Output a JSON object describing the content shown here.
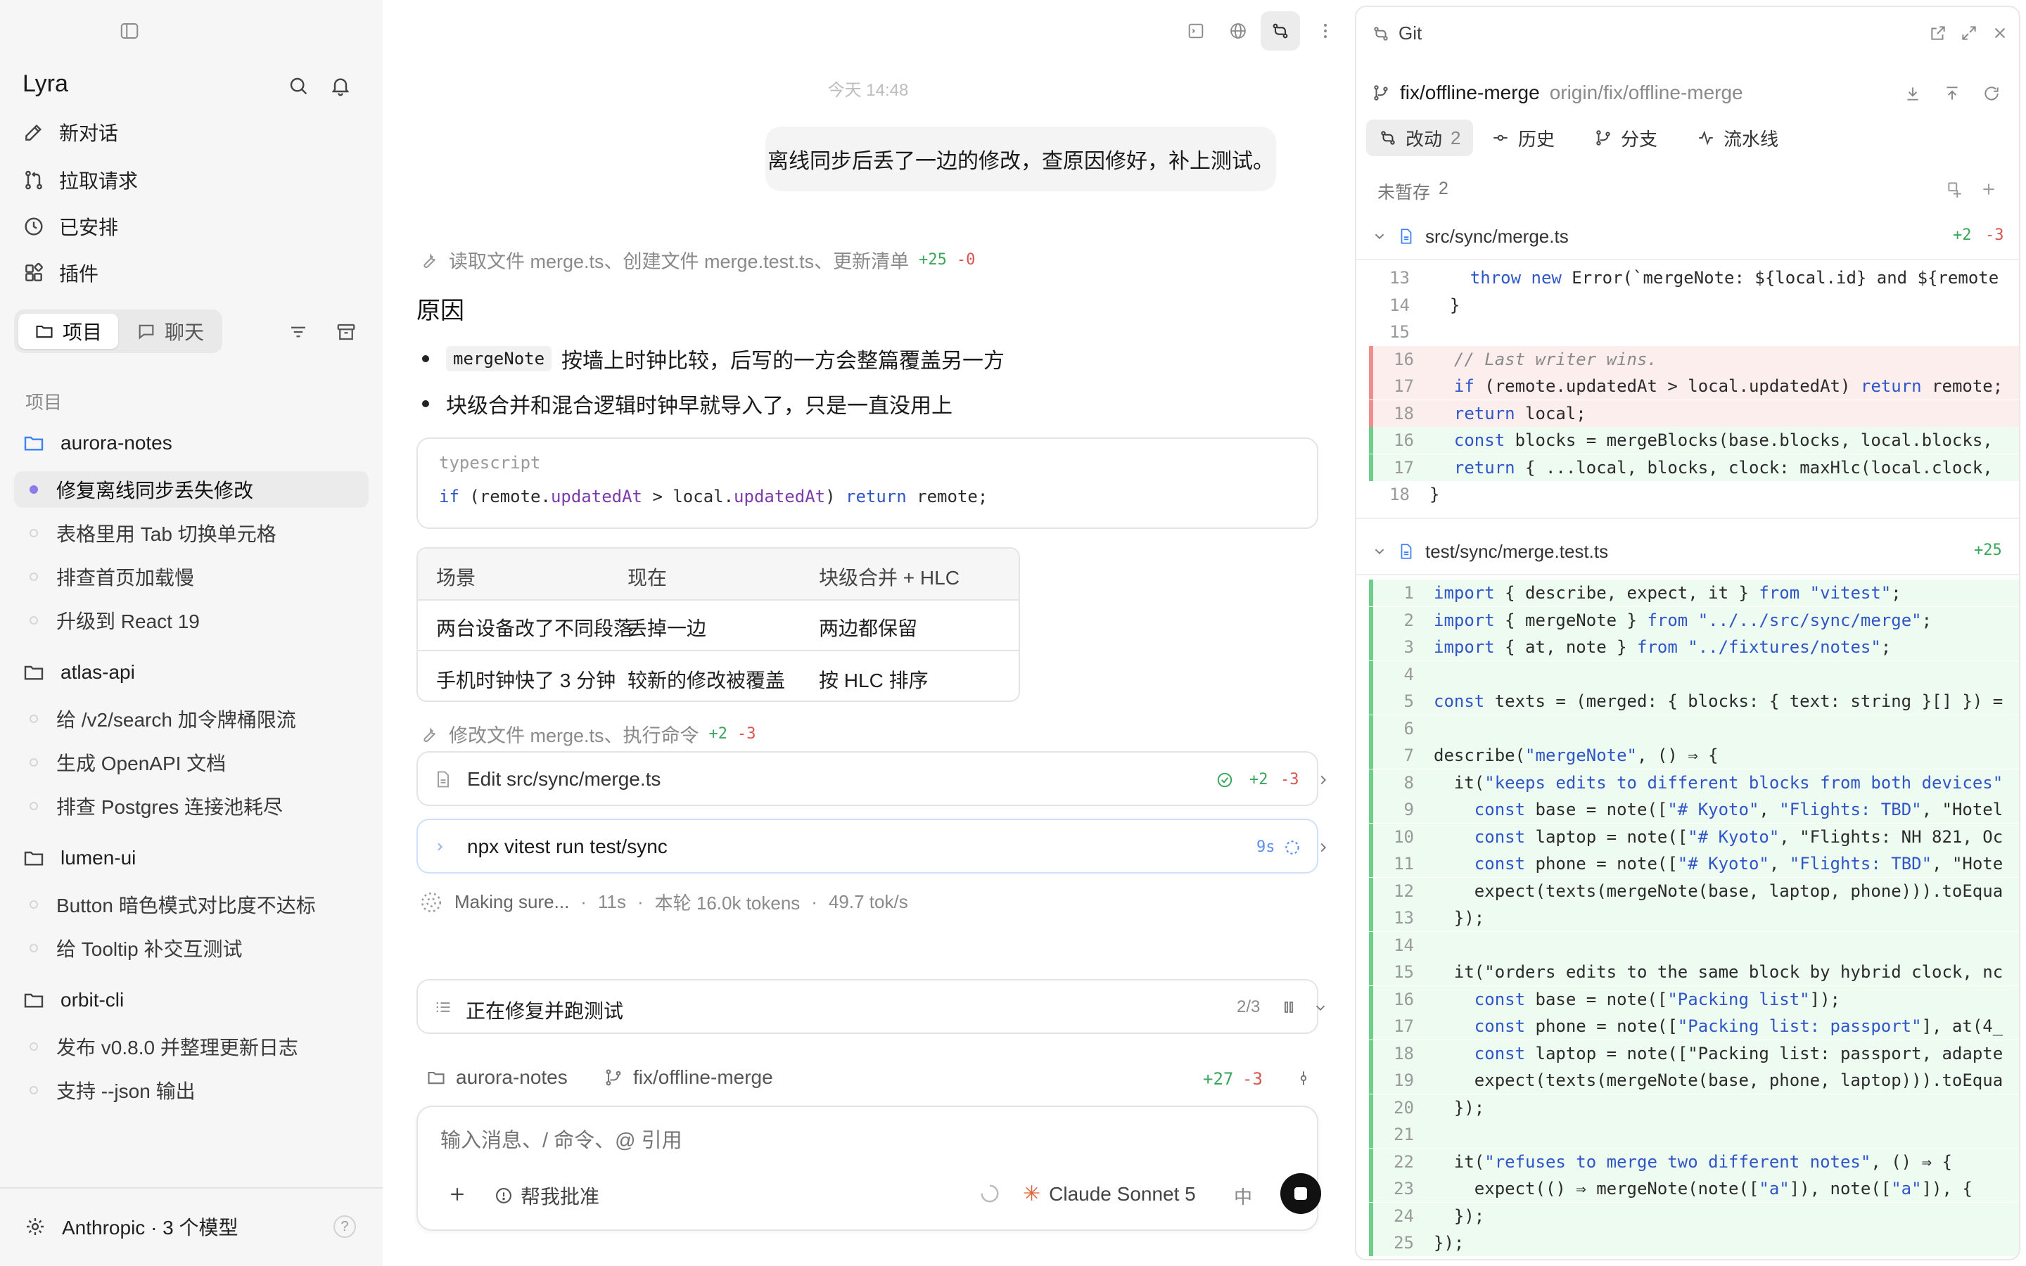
{
  "sidebar": {
    "app_name": "Lyra",
    "nav": [
      {
        "label": "新对话",
        "icon": "edit-icon"
      },
      {
        "label": "拉取请求",
        "icon": "pull-request-icon"
      },
      {
        "label": "已安排",
        "icon": "clock-icon"
      },
      {
        "label": "插件",
        "icon": "plugin-icon"
      }
    ],
    "tabs": {
      "projects": "项目",
      "chats": "聊天"
    },
    "section_label": "项目",
    "projects": [
      {
        "name": "aurora-notes",
        "tasks": [
          "修复离线同步丢失修改",
          "表格里用 Tab 切换单元格",
          "排查首页加载慢",
          "升级到 React 19"
        ]
      },
      {
        "name": "atlas-api",
        "tasks": [
          "给 /v2/search 加令牌桶限流",
          "生成 OpenAPI 文档",
          "排查 Postgres 连接池耗尽"
        ]
      },
      {
        "name": "lumen-ui",
        "tasks": [
          "Button 暗色模式对比度不达标",
          "给 Tooltip 补交互测试"
        ]
      },
      {
        "name": "orbit-cli",
        "tasks": [
          "发布 v0.8.0 并整理更新日志",
          "支持 --json 输出"
        ]
      }
    ],
    "active_task": "修复离线同步丢失修改",
    "footer": {
      "provider": "Anthropic · 3 个模型",
      "help": "?"
    }
  },
  "chat": {
    "timestamp": "今天 14:48",
    "user_message": "离线同步后丢了一边的修改，查原因修好，补上测试。",
    "tool_summary_1": {
      "text": "读取文件 merge.ts、创建文件 merge.test.ts、更新清单",
      "add": "+25",
      "del": "-0"
    },
    "heading": "原因",
    "bullets": [
      {
        "code": "mergeNote",
        "text": "按墙上时钟比较，后写的一方会整篇覆盖另一方"
      },
      {
        "code": "",
        "text": "块级合并和混合逻辑时钟早就导入了，只是一直没用上"
      }
    ],
    "code_block": {
      "lang": "typescript",
      "code_parts": [
        "if",
        " (remote.",
        "updatedAt",
        " > local.",
        "updatedAt",
        ") ",
        "return",
        " remote;"
      ]
    },
    "table": {
      "headers": [
        "场景",
        "现在",
        "块级合并 + HLC"
      ],
      "rows": [
        [
          "两台设备改了不同段落",
          "丢掉一边",
          "两边都保留"
        ],
        [
          "手机时钟快了 3 分钟",
          "较新的修改被覆盖",
          "按 HLC 排序"
        ]
      ]
    },
    "tool_summary_2": {
      "text": "修改文件 merge.ts、执行命令",
      "add": "+2",
      "del": "-3"
    },
    "edit_card": {
      "label": "Edit src/sync/merge.ts",
      "add": "+2",
      "del": "-3"
    },
    "command_card": {
      "label": "npx vitest run test/sync",
      "time": "9s"
    },
    "status": {
      "text": "Making sure...",
      "elapsed": "11s",
      "tokens": "本轮 16.0k tokens",
      "rate": "49.7 tok/s"
    },
    "plan": {
      "title": "正在修复并跑测试",
      "progress": "2/3"
    },
    "context": {
      "project": "aurora-notes",
      "branch": "fix/offline-merge",
      "add": "+27",
      "del": "-3"
    },
    "composer": {
      "placeholder": "输入消息、/ 命令、@ 引用",
      "approve_label": "帮我批准",
      "model": "Claude Sonnet 5",
      "lang": "中"
    }
  },
  "git": {
    "title": "Git",
    "branch": "fix/offline-merge",
    "remote": "origin/fix/offline-merge",
    "tabs": [
      {
        "label": "改动",
        "count": "2",
        "icon": "diff-icon"
      },
      {
        "label": "历史",
        "icon": "commit-icon"
      },
      {
        "label": "分支",
        "icon": "branch-icon"
      },
      {
        "label": "流水线",
        "icon": "pipeline-icon"
      }
    ],
    "unstaged_label": "未暂存",
    "unstaged_count": "2",
    "files": [
      {
        "path": "src/sync/merge.ts",
        "add": "+2",
        "del": "-3"
      },
      {
        "path": "test/sync/merge.test.ts",
        "add": "+25",
        "del": ""
      }
    ],
    "diff1": [
      {
        "n": "13",
        "t": "    throw new Error(`mergeNote: ${local.id} and ${remote",
        "k": "ctx"
      },
      {
        "n": "14",
        "t": "  }",
        "k": "ctx"
      },
      {
        "n": "15",
        "t": "",
        "k": "ctx"
      },
      {
        "n": "16",
        "t": "  // Last writer wins.",
        "k": "del"
      },
      {
        "n": "17",
        "t": "  if (remote.updatedAt > local.updatedAt) return remote;",
        "k": "del"
      },
      {
        "n": "18",
        "t": "  return local;",
        "k": "del"
      },
      {
        "n": "16",
        "t": "  const blocks = mergeBlocks(base.blocks, local.blocks,",
        "k": "add"
      },
      {
        "n": "17",
        "t": "  return { ...local, blocks, clock: maxHlc(local.clock,",
        "k": "add"
      },
      {
        "n": "18",
        "t": "}",
        "k": "ctx"
      }
    ],
    "diff2": [
      {
        "n": "1",
        "t": "import { describe, expect, it } from \"vitest\";"
      },
      {
        "n": "2",
        "t": "import { mergeNote } from \"../../src/sync/merge\";"
      },
      {
        "n": "3",
        "t": "import { at, note } from \"../fixtures/notes\";"
      },
      {
        "n": "4",
        "t": ""
      },
      {
        "n": "5",
        "t": "const texts = (merged: { blocks: { text: string }[] }) ="
      },
      {
        "n": "6",
        "t": ""
      },
      {
        "n": "7",
        "t": "describe(\"mergeNote\", () ⇒ {"
      },
      {
        "n": "8",
        "t": "  it(\"keeps edits to different blocks from both devices\""
      },
      {
        "n": "9",
        "t": "    const base = note([\"# Kyoto\", \"Flights: TBD\", \"Hotel"
      },
      {
        "n": "10",
        "t": "    const laptop = note([\"# Kyoto\", \"Flights: NH 821, Oc"
      },
      {
        "n": "11",
        "t": "    const phone = note([\"# Kyoto\", \"Flights: TBD\", \"Hote"
      },
      {
        "n": "12",
        "t": "    expect(texts(mergeNote(base, laptop, phone))).toEqua"
      },
      {
        "n": "13",
        "t": "  });"
      },
      {
        "n": "14",
        "t": ""
      },
      {
        "n": "15",
        "t": "  it(\"orders edits to the same block by hybrid clock, nc"
      },
      {
        "n": "16",
        "t": "    const base = note([\"Packing list\"]);"
      },
      {
        "n": "17",
        "t": "    const phone = note([\"Packing list: passport\"], at(4_"
      },
      {
        "n": "18",
        "t": "    const laptop = note([\"Packing list: passport, adapte"
      },
      {
        "n": "19",
        "t": "    expect(texts(mergeNote(base, phone, laptop))).toEqua"
      },
      {
        "n": "20",
        "t": "  });"
      },
      {
        "n": "21",
        "t": ""
      },
      {
        "n": "22",
        "t": "  it(\"refuses to merge two different notes\", () ⇒ {"
      },
      {
        "n": "23",
        "t": "    expect(() ⇒ mergeNote(note([\"a\"]), note([\"a\"]), {"
      },
      {
        "n": "24",
        "t": "  });"
      },
      {
        "n": "25",
        "t": "});"
      }
    ]
  },
  "colors": {
    "accent_purple": "#8c7be8",
    "add_green": "#3aa65c",
    "del_red": "#d9534f",
    "keyword_blue": "#2f56c7",
    "model_orange": "#e0643a"
  }
}
